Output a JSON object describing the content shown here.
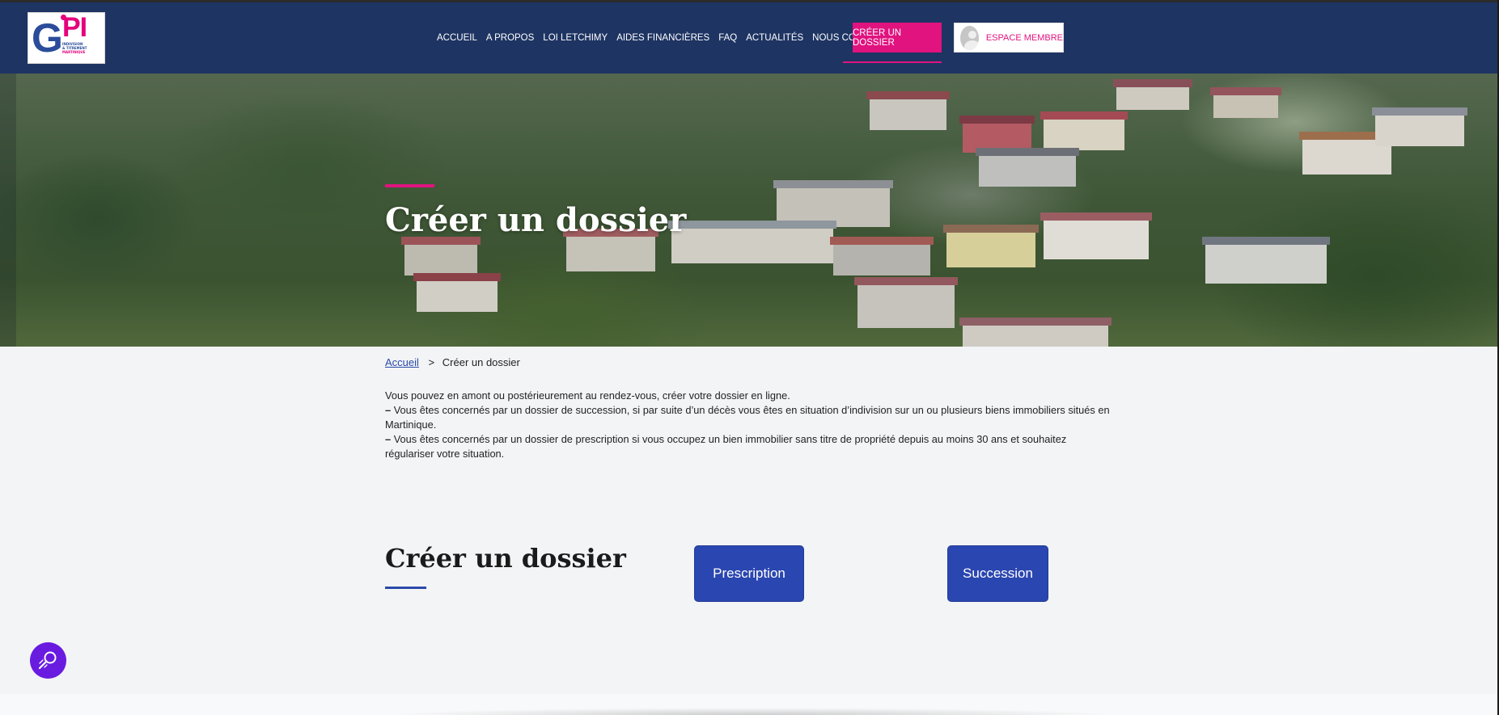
{
  "header": {
    "logo": {
      "text_main": "GIPI",
      "text_sub_1": "Indivision",
      "text_sub_2": "& Titrement",
      "text_sub_3": "Martinique"
    },
    "nav": [
      {
        "label": "ACCUEIL"
      },
      {
        "label": "A PROPOS"
      },
      {
        "label": "LOI LETCHIMY"
      },
      {
        "label": "AIDES FINANCIÈRES"
      },
      {
        "label": "FAQ"
      },
      {
        "label": "ACTUALITÉS"
      },
      {
        "label": "NOUS CONTACTER"
      }
    ],
    "create_button_label": "CRÉER UN DOSSIER",
    "member_button_label": "ESPACE MEMBRE"
  },
  "hero": {
    "title": "Créer un dossier"
  },
  "breadcrumb": {
    "home": "Accueil",
    "separator": ">",
    "current": "Créer un dossier"
  },
  "intro": {
    "line1": "Vous pouvez en amont ou postérieurement au rendez-vous, créer votre dossier en ligne.",
    "dash": "–",
    "line2": "Vous êtes concernés par un dossier de succession, si par suite d’un décès vous êtes en situation d’indivision sur un ou plusieurs biens immobiliers situés en Martinique.",
    "line3": "Vous êtes concernés par un dossier de prescription si vous occupez un bien immobilier sans titre de propriété depuis au moins 30 ans et souhaitez régulariser votre situation."
  },
  "section": {
    "title": "Créer un dossier",
    "buttons": {
      "prescription": "Prescription",
      "succession": "Succession"
    }
  },
  "colors": {
    "header_bg": "#1e3463",
    "accent_pink": "#e0137f",
    "primary_blue": "#2a46b0",
    "accessibility_purple": "#6a1be0"
  },
  "icons": {
    "avatar": "user-avatar-icon",
    "accessibility": "accessibility-magnifier-icon"
  }
}
